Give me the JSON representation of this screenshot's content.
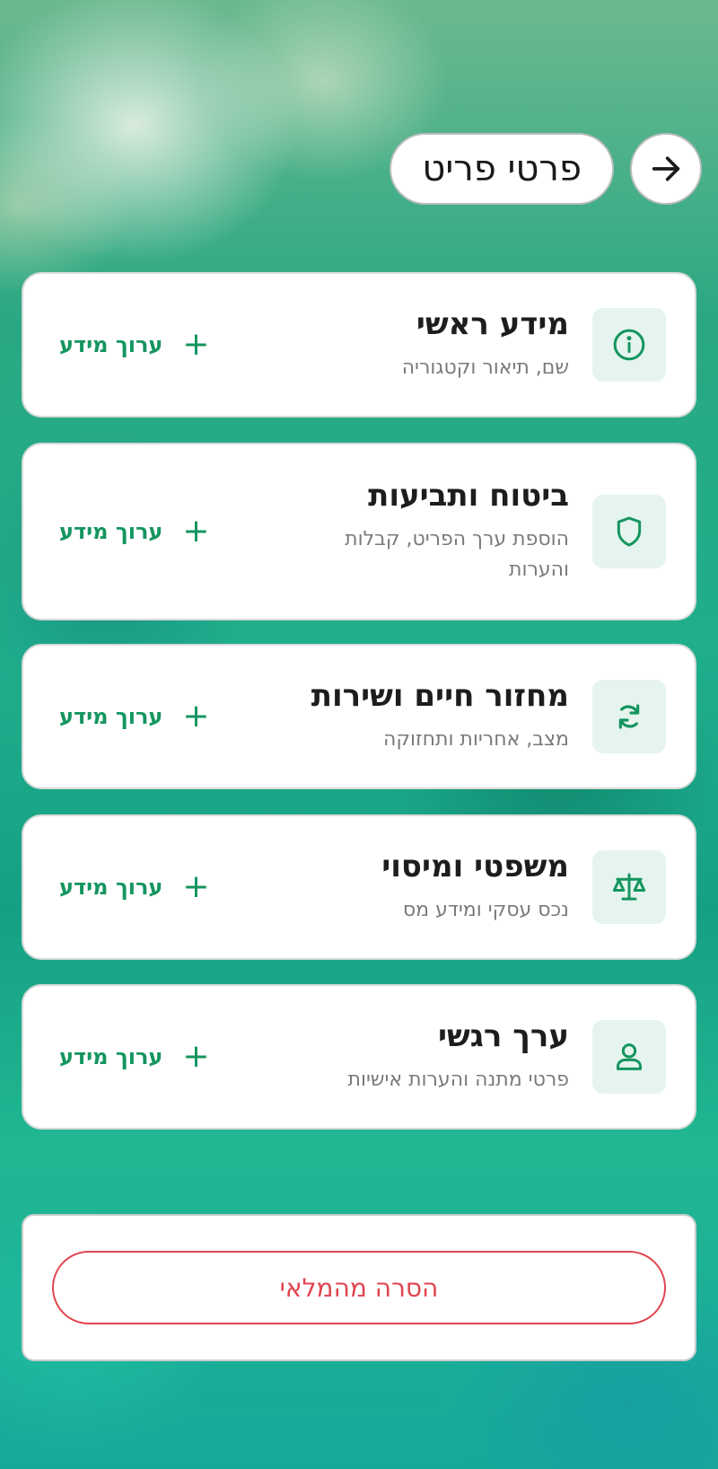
{
  "header": {
    "title": "פרטי פריט",
    "back_icon": "arrow-right-icon"
  },
  "accent_color": "#14955f",
  "danger_color": "#e0454f",
  "sections": [
    {
      "title": "מידע ראשי",
      "subtitle": "שם, תיאור וקטגוריה",
      "icon": "info-icon",
      "action": "ערוך מידע"
    },
    {
      "title": "ביטוח ותביעות",
      "subtitle": "הוספת ערך הפריט, קבלות והערות",
      "icon": "shield-icon",
      "action": "ערוך מידע"
    },
    {
      "title": "מחזור חיים ושירות",
      "subtitle": "מצב, אחריות ותחזוקה",
      "icon": "refresh-icon",
      "action": "ערוך מידע"
    },
    {
      "title": "משפטי ומיסוי",
      "subtitle": "נכס עסקי ומידע מס",
      "icon": "scale-icon",
      "action": "ערוך מידע"
    },
    {
      "title": "ערך רגשי",
      "subtitle": "פרטי מתנה והערות אישיות",
      "icon": "user-icon",
      "action": "ערוך מידע"
    }
  ],
  "footer": {
    "remove_label": "הסרה מהמלאי"
  }
}
